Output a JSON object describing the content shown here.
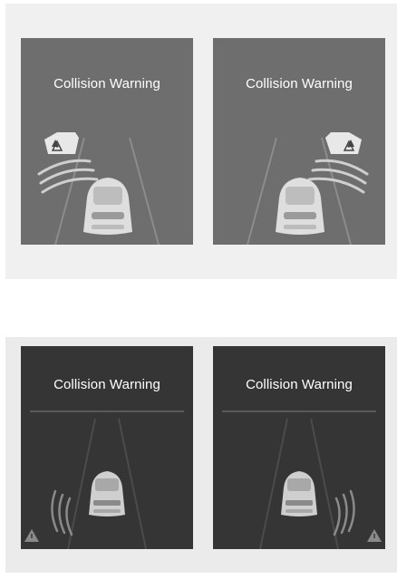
{
  "panels": {
    "top_left": {
      "title": "Collision Warning",
      "warning_side": "left"
    },
    "top_right": {
      "title": "Collision Warning",
      "warning_side": "right"
    },
    "bottom_left": {
      "title": "Collision Warning",
      "warning_side": "left"
    },
    "bottom_right": {
      "title": "Collision Warning",
      "warning_side": "right"
    }
  },
  "icons": {
    "warning": "warning-triangle-icon",
    "vehicle": "car-icon",
    "obstacle": "vehicle-object-icon",
    "wave": "radar-wave-icon"
  },
  "colors": {
    "light_panel": "#6e6e6e",
    "dark_panel": "#353535",
    "background_light": "#f0f0f0",
    "background_dark": "#ebebeb",
    "text": "#ffffff"
  }
}
